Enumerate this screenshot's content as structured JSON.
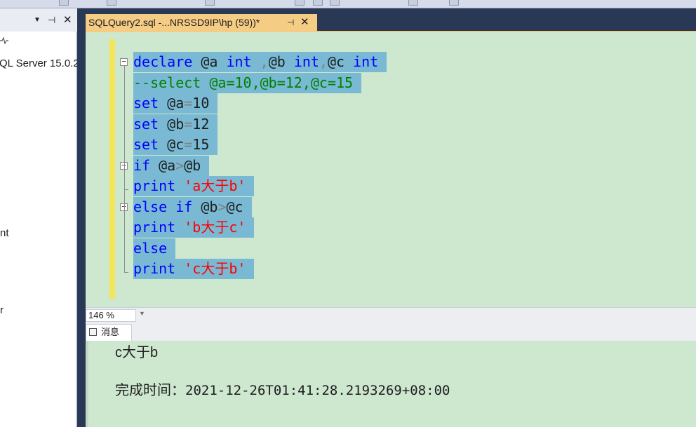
{
  "editor_tab": {
    "title": "SQLQuery2.sql -...NRSSD9IP\\hp (59))*",
    "pin": "⊣",
    "close": "✕"
  },
  "explorer": {
    "controls": {
      "dropdown": "▼",
      "pin": "⊣",
      "close": "✕"
    },
    "server_node": "QL Server 15.0.2",
    "fragments": [
      "nt",
      "r"
    ]
  },
  "code": [
    {
      "fold": "start",
      "tokens": [
        {
          "t": "declare",
          "c": "kw"
        },
        {
          "t": " @a ",
          "c": "id"
        },
        {
          "t": "int",
          "c": "kw"
        },
        {
          "t": " ,",
          "c": "op"
        },
        {
          "t": "@b ",
          "c": "id"
        },
        {
          "t": "int",
          "c": "kw"
        },
        {
          "t": ",",
          "c": "op"
        },
        {
          "t": "@c ",
          "c": "id"
        },
        {
          "t": "int",
          "c": "kw"
        }
      ]
    },
    {
      "tokens": [
        {
          "t": "--select @a=10,@b=12,@c=15",
          "c": "cm"
        }
      ]
    },
    {
      "tokens": [
        {
          "t": "set",
          "c": "kw"
        },
        {
          "t": " @a",
          "c": "id"
        },
        {
          "t": "=",
          "c": "op"
        },
        {
          "t": "10",
          "c": "id"
        }
      ]
    },
    {
      "tokens": [
        {
          "t": "set",
          "c": "kw"
        },
        {
          "t": " @b",
          "c": "id"
        },
        {
          "t": "=",
          "c": "op"
        },
        {
          "t": "12",
          "c": "id"
        }
      ]
    },
    {
      "tokens": [
        {
          "t": "set",
          "c": "kw"
        },
        {
          "t": " @c",
          "c": "id"
        },
        {
          "t": "=",
          "c": "op"
        },
        {
          "t": "15",
          "c": "id"
        }
      ]
    },
    {
      "fold": "start",
      "tokens": [
        {
          "t": "if",
          "c": "kw"
        },
        {
          "t": " @a",
          "c": "id"
        },
        {
          "t": ">",
          "c": "op"
        },
        {
          "t": "@b",
          "c": "id"
        }
      ]
    },
    {
      "fold": "end",
      "tokens": [
        {
          "t": "print",
          "c": "kw"
        },
        {
          "t": " ",
          "c": "id"
        },
        {
          "t": "'a大于b'",
          "c": "st"
        }
      ]
    },
    {
      "fold": "start",
      "tokens": [
        {
          "t": "else",
          "c": "kw"
        },
        {
          "t": " ",
          "c": "id"
        },
        {
          "t": "if",
          "c": "kw"
        },
        {
          "t": " @b",
          "c": "id"
        },
        {
          "t": ">",
          "c": "op"
        },
        {
          "t": "@c",
          "c": "id"
        }
      ]
    },
    {
      "tokens": [
        {
          "t": "print",
          "c": "kw"
        },
        {
          "t": " ",
          "c": "id"
        },
        {
          "t": "'b大于c'",
          "c": "st"
        }
      ]
    },
    {
      "tokens": [
        {
          "t": "else",
          "c": "kw"
        }
      ]
    },
    {
      "fold": "end",
      "tokens": [
        {
          "t": "print",
          "c": "kw"
        },
        {
          "t": " ",
          "c": "id"
        },
        {
          "t": "'c大于b'",
          "c": "st"
        }
      ]
    }
  ],
  "zoom": {
    "value": "146 %",
    "arrow": "▼"
  },
  "results": {
    "tab_label": "消息",
    "output_text": "c大于b",
    "completion_label": "完成时间：",
    "completion_time": "2021-12-26T01:41:28.2193269+08:00"
  },
  "colors": {
    "editor_bg": "#cee7cf",
    "selection": "#79b9d3",
    "keyword": "#0000ff",
    "comment": "#008000",
    "string": "#ff0000",
    "tab_active": "#f5cc84",
    "chrome": "#293955"
  }
}
